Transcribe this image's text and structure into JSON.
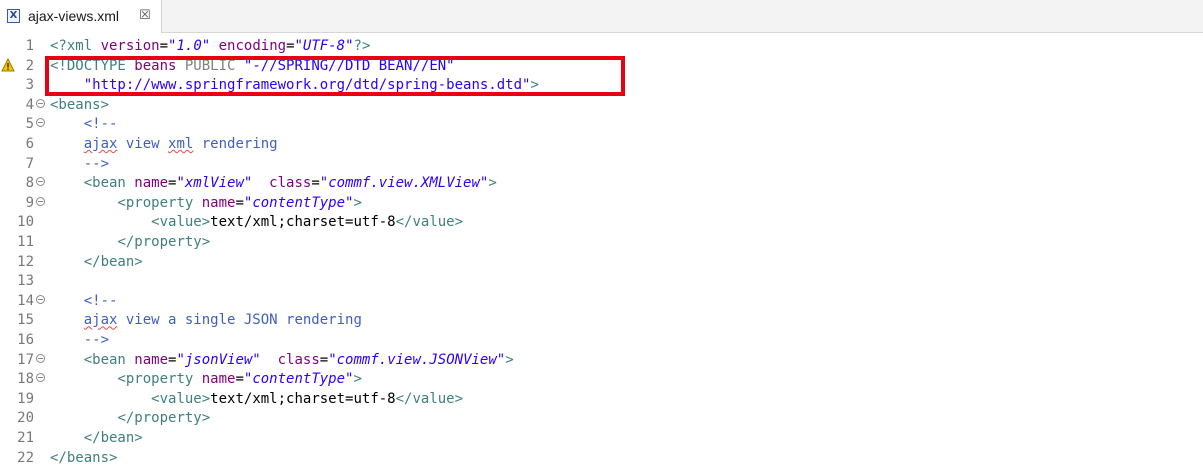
{
  "tab": {
    "icon": "xml-file-icon",
    "icon_glyph": "X",
    "label": "ajax-views.xml",
    "close_glyph": "☒"
  },
  "warning": {
    "icon": "warning-icon",
    "line": 2
  },
  "lines": [
    {
      "n": "1",
      "fold": false,
      "segs": [
        {
          "c": "t",
          "x": "<?xml "
        },
        {
          "c": "a",
          "x": "version"
        },
        {
          "c": "",
          "x": "="
        },
        {
          "c": "v",
          "x": "\"1.0\""
        },
        {
          "c": "",
          "x": " "
        },
        {
          "c": "a",
          "x": "encoding"
        },
        {
          "c": "",
          "x": "="
        },
        {
          "c": "v",
          "x": "\"UTF-8\""
        },
        {
          "c": "t",
          "x": "?>"
        }
      ]
    },
    {
      "n": "2",
      "fold": false,
      "segs": [
        {
          "c": "t",
          "x": "<!DOCTYPE "
        },
        {
          "c": "a",
          "x": "beans"
        },
        {
          "c": "d",
          "x": " PUBLIC "
        },
        {
          "c": "vn",
          "x": "\"-//SPRING//DTD BEAN//EN\""
        }
      ]
    },
    {
      "n": "3",
      "fold": false,
      "segs": [
        {
          "c": "",
          "x": "    "
        },
        {
          "c": "vn",
          "x": "\"http://www.springframework.org/dtd/spring-beans.dtd\""
        },
        {
          "c": "t",
          "x": ">"
        }
      ]
    },
    {
      "n": "4",
      "fold": true,
      "segs": [
        {
          "c": "t",
          "x": "<beans>"
        }
      ]
    },
    {
      "n": "5",
      "fold": true,
      "segs": [
        {
          "c": "",
          "x": "    "
        },
        {
          "c": "c",
          "x": "<!--"
        }
      ]
    },
    {
      "n": "6",
      "fold": false,
      "segs": [
        {
          "c": "",
          "x": "    "
        },
        {
          "c": "c sq",
          "x": "ajax"
        },
        {
          "c": "c",
          "x": " view "
        },
        {
          "c": "c sq",
          "x": "xml"
        },
        {
          "c": "c",
          "x": " rendering"
        }
      ]
    },
    {
      "n": "7",
      "fold": false,
      "segs": [
        {
          "c": "",
          "x": "    "
        },
        {
          "c": "c",
          "x": "-->"
        }
      ]
    },
    {
      "n": "8",
      "fold": true,
      "segs": [
        {
          "c": "",
          "x": "    "
        },
        {
          "c": "t",
          "x": "<bean "
        },
        {
          "c": "a",
          "x": "name"
        },
        {
          "c": "",
          "x": "="
        },
        {
          "c": "v",
          "x": "\"xmlView\""
        },
        {
          "c": "",
          "x": "  "
        },
        {
          "c": "a",
          "x": "class"
        },
        {
          "c": "",
          "x": "="
        },
        {
          "c": "v",
          "x": "\"commf.view.XMLView\""
        },
        {
          "c": "t",
          "x": ">"
        }
      ]
    },
    {
      "n": "9",
      "fold": true,
      "segs": [
        {
          "c": "",
          "x": "        "
        },
        {
          "c": "t",
          "x": "<property "
        },
        {
          "c": "a",
          "x": "name"
        },
        {
          "c": "",
          "x": "="
        },
        {
          "c": "v",
          "x": "\"contentType\""
        },
        {
          "c": "t",
          "x": ">"
        }
      ]
    },
    {
      "n": "10",
      "fold": false,
      "segs": [
        {
          "c": "",
          "x": "            "
        },
        {
          "c": "t",
          "x": "<value>"
        },
        {
          "c": "",
          "x": "text/xml;charset=utf-8"
        },
        {
          "c": "t",
          "x": "</value>"
        }
      ]
    },
    {
      "n": "11",
      "fold": false,
      "segs": [
        {
          "c": "",
          "x": "        "
        },
        {
          "c": "t",
          "x": "</property>"
        }
      ]
    },
    {
      "n": "12",
      "fold": false,
      "segs": [
        {
          "c": "",
          "x": "    "
        },
        {
          "c": "t",
          "x": "</bean>"
        }
      ]
    },
    {
      "n": "13",
      "fold": false,
      "segs": []
    },
    {
      "n": "14",
      "fold": true,
      "segs": [
        {
          "c": "",
          "x": "    "
        },
        {
          "c": "c",
          "x": "<!--"
        }
      ]
    },
    {
      "n": "15",
      "fold": false,
      "segs": [
        {
          "c": "",
          "x": "    "
        },
        {
          "c": "c sq",
          "x": "ajax"
        },
        {
          "c": "c",
          "x": " view a single JSON rendering"
        }
      ]
    },
    {
      "n": "16",
      "fold": false,
      "segs": [
        {
          "c": "",
          "x": "    "
        },
        {
          "c": "c",
          "x": "-->"
        }
      ]
    },
    {
      "n": "17",
      "fold": true,
      "segs": [
        {
          "c": "",
          "x": "    "
        },
        {
          "c": "t",
          "x": "<bean "
        },
        {
          "c": "a",
          "x": "name"
        },
        {
          "c": "",
          "x": "="
        },
        {
          "c": "v",
          "x": "\"jsonView\""
        },
        {
          "c": "",
          "x": "  "
        },
        {
          "c": "a",
          "x": "class"
        },
        {
          "c": "",
          "x": "="
        },
        {
          "c": "v",
          "x": "\"commf.view.JSONView\""
        },
        {
          "c": "t",
          "x": ">"
        }
      ]
    },
    {
      "n": "18",
      "fold": true,
      "segs": [
        {
          "c": "",
          "x": "        "
        },
        {
          "c": "t",
          "x": "<property "
        },
        {
          "c": "a",
          "x": "name"
        },
        {
          "c": "",
          "x": "="
        },
        {
          "c": "v",
          "x": "\"contentType\""
        },
        {
          "c": "t",
          "x": ">"
        }
      ]
    },
    {
      "n": "19",
      "fold": false,
      "segs": [
        {
          "c": "",
          "x": "            "
        },
        {
          "c": "t",
          "x": "<value>"
        },
        {
          "c": "",
          "x": "text/xml;charset=utf-8"
        },
        {
          "c": "t",
          "x": "</value>"
        }
      ]
    },
    {
      "n": "20",
      "fold": false,
      "segs": [
        {
          "c": "",
          "x": "        "
        },
        {
          "c": "t",
          "x": "</property>"
        }
      ]
    },
    {
      "n": "21",
      "fold": false,
      "segs": [
        {
          "c": "",
          "x": "    "
        },
        {
          "c": "t",
          "x": "</bean>"
        }
      ]
    },
    {
      "n": "22",
      "fold": false,
      "segs": [
        {
          "c": "t",
          "x": "</beans>"
        }
      ]
    }
  ],
  "colors": {
    "tag": "#3f7f7f",
    "attribute": "#7f007f",
    "value": "#2a00ff",
    "comment": "#3f5fbf",
    "highlight_box": "#e60012"
  }
}
